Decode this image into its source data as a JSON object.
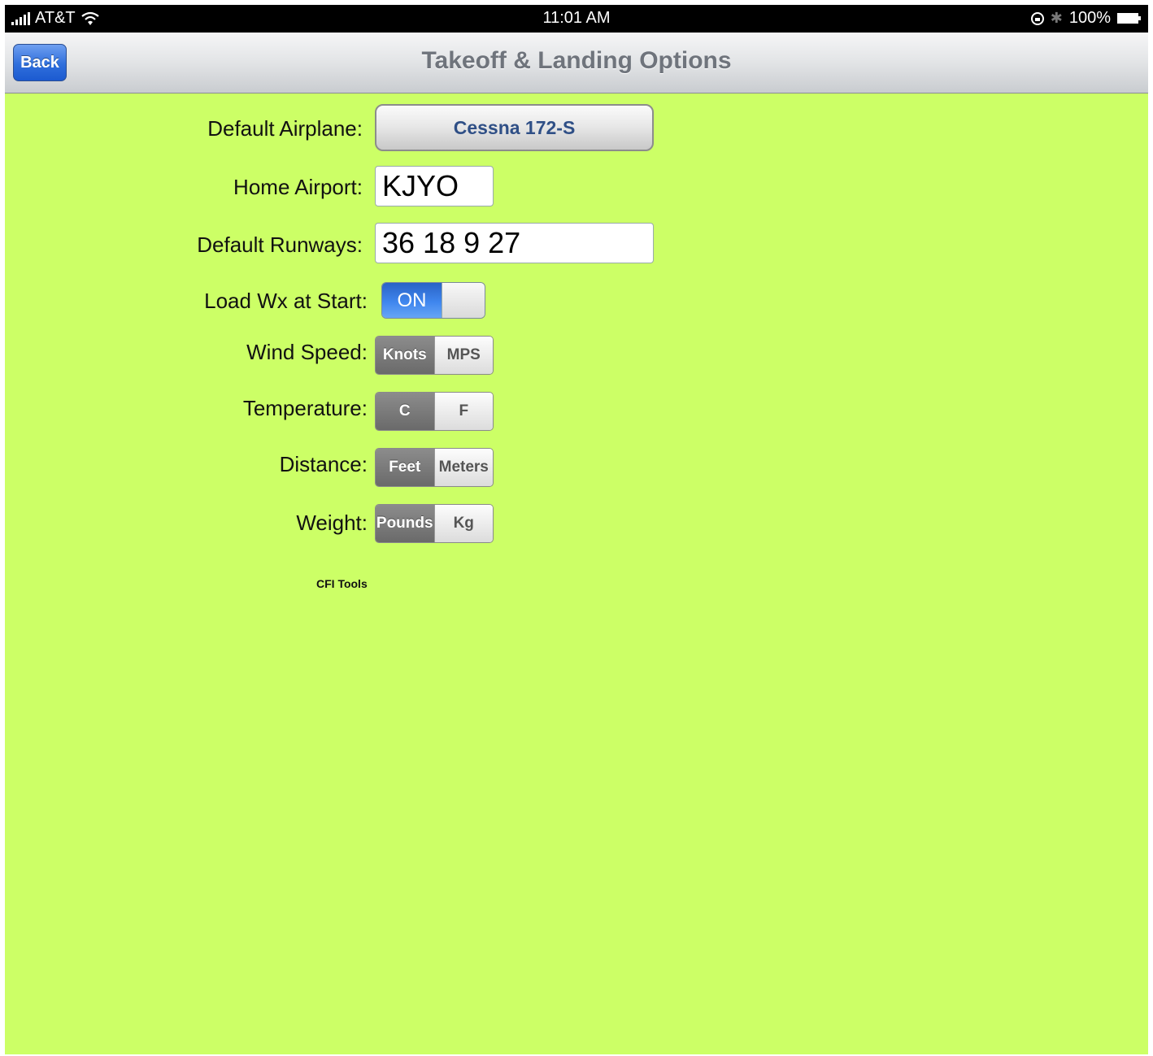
{
  "status_bar": {
    "carrier": "AT&T",
    "time": "11:01 AM",
    "battery": "100%",
    "icons": [
      "signal-bars-icon",
      "wifi-icon",
      "rotation-lock-icon",
      "bluetooth-icon",
      "battery-icon"
    ]
  },
  "navbar": {
    "back_label": "Back",
    "title": "Takeoff & Landing Options"
  },
  "form": {
    "default_airplane": {
      "label": "Default Airplane:",
      "value": "Cessna 172-S"
    },
    "home_airport": {
      "label": "Home Airport:",
      "value": "KJYO"
    },
    "default_runways": {
      "label": "Default Runways:",
      "value": "36 18 9 27"
    },
    "load_wx": {
      "label": "Load Wx at Start:",
      "state": "ON"
    },
    "wind_speed": {
      "label": "Wind Speed:",
      "options": [
        "Knots",
        "MPS"
      ],
      "selected": "Knots"
    },
    "temperature": {
      "label": "Temperature:",
      "options": [
        "C",
        "F"
      ],
      "selected": "C"
    },
    "distance": {
      "label": "Distance:",
      "options": [
        "Feet",
        "Meters"
      ],
      "selected": "Feet"
    },
    "weight": {
      "label": "Weight:",
      "options": [
        "Pounds",
        "Kg"
      ],
      "selected": "Pounds"
    }
  },
  "footer": {
    "text": "CFI Tools"
  },
  "colors": {
    "background": "#ccff66",
    "switch_on": "#3f86ee",
    "back_button": "#2f6fdc",
    "airplane_text": "#2f4f86"
  }
}
